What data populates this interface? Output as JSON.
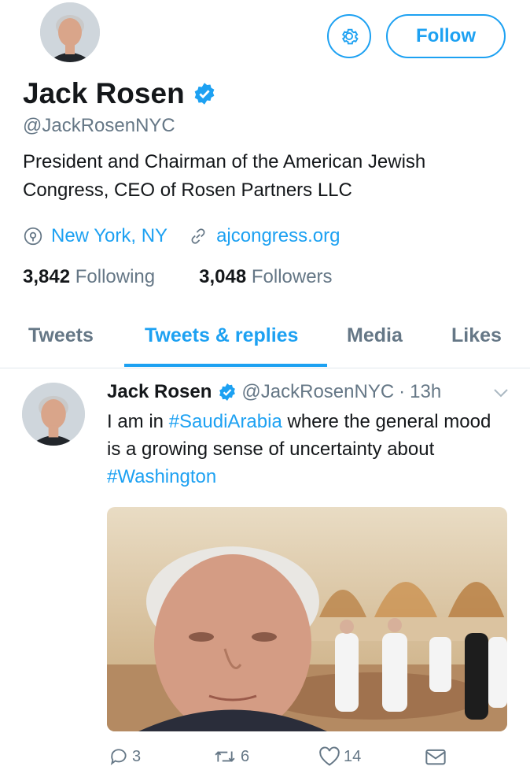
{
  "profile": {
    "name": "Jack Rosen",
    "handle": "@JackRosenNYC",
    "bio": "President and Chairman of the American Jewish Congress, CEO of Rosen Partners LLC",
    "location": "New York, NY",
    "website": "ajcongress.org",
    "following_count": "3,842",
    "following_label": "Following",
    "followers_count": "3,048",
    "followers_label": "Followers",
    "verified": true
  },
  "header": {
    "follow_label": "Follow",
    "settings_icon": "gear-icon"
  },
  "tabs": [
    {
      "label": "Tweets",
      "active": false
    },
    {
      "label": "Tweets & replies",
      "active": true
    },
    {
      "label": "Media",
      "active": false
    },
    {
      "label": "Likes",
      "active": false
    }
  ],
  "tweet": {
    "author": "Jack Rosen",
    "handle": "@JackRosenNYC",
    "separator": "·",
    "time": "13h",
    "text_1": "I am in ",
    "hashtag_1": "#SaudiArabia",
    "text_2": " where the general mood is a growing sense of uncertainty about ",
    "hashtag_2": "#Washington",
    "replies": "3",
    "retweets": "6",
    "likes": "14"
  },
  "colors": {
    "accent": "#1da1f2",
    "text": "#14171a",
    "secondary": "#657786"
  }
}
